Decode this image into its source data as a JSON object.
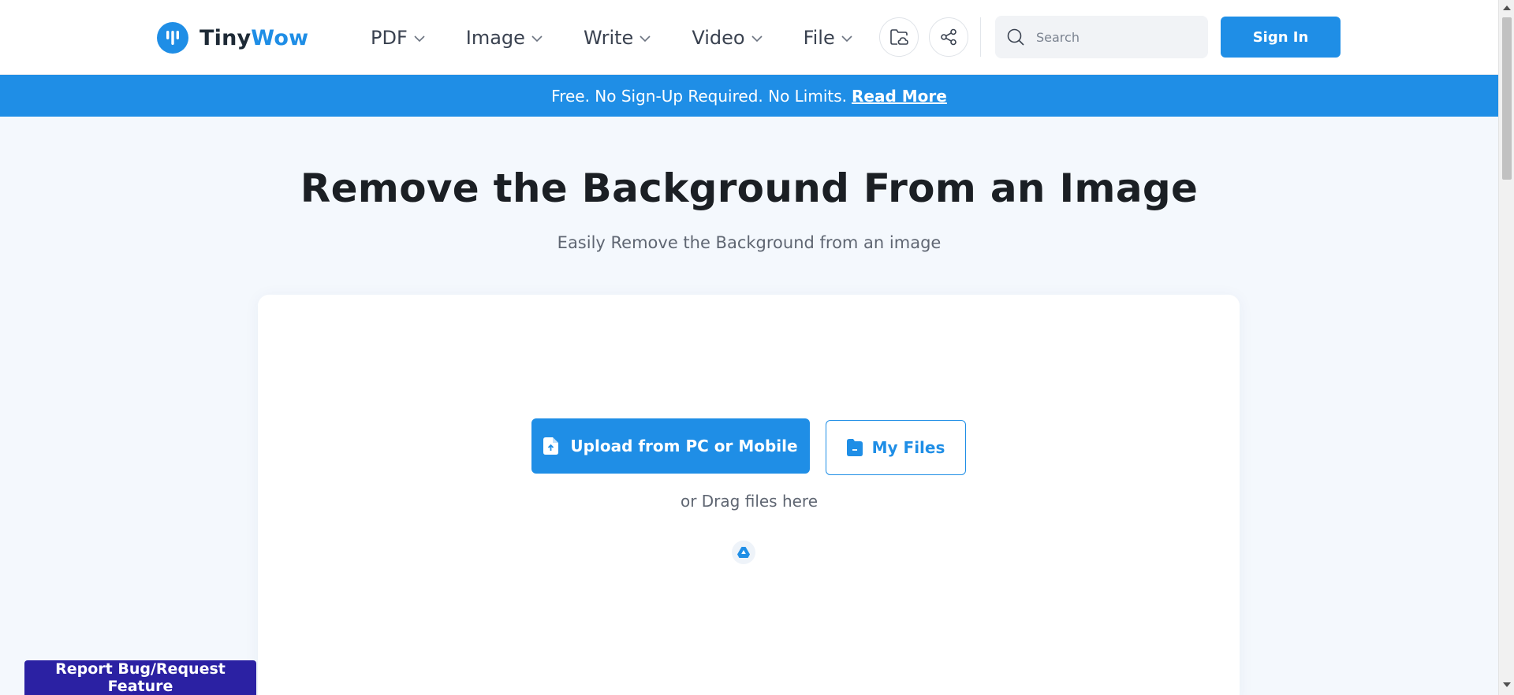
{
  "brand": {
    "name_part1": "Tiny",
    "name_part2": "Wow",
    "logo_icon": "tinywow-logo-icon",
    "color": "#1f8ee6"
  },
  "nav": {
    "items": [
      {
        "label": "PDF"
      },
      {
        "label": "Image"
      },
      {
        "label": "Write"
      },
      {
        "label": "Video"
      },
      {
        "label": "File"
      }
    ],
    "chevron_icon": "chevron-down-icon"
  },
  "header": {
    "folder_icon": "folder-cloud-icon",
    "share_icon": "share-icon",
    "search": {
      "placeholder": "Search",
      "value": "",
      "icon": "search-icon"
    },
    "signin_label": "Sign In"
  },
  "banner": {
    "text": "Free. No Sign-Up Required. No Limits.",
    "link": "Read More",
    "color": "#1f8ee6"
  },
  "hero": {
    "title": "Remove the Background From an Image",
    "subtitle": "Easily Remove the Background from an image"
  },
  "upload": {
    "upload_label": "Upload from PC or Mobile",
    "upload_icon": "file-upload-icon",
    "myfiles_label": "My Files",
    "myfiles_icon": "folder-icon",
    "drag_text": "or Drag files here",
    "gdrive_icon": "google-drive-icon"
  },
  "report": {
    "label": "Report Bug/Request Feature",
    "color": "#2b21a3"
  }
}
